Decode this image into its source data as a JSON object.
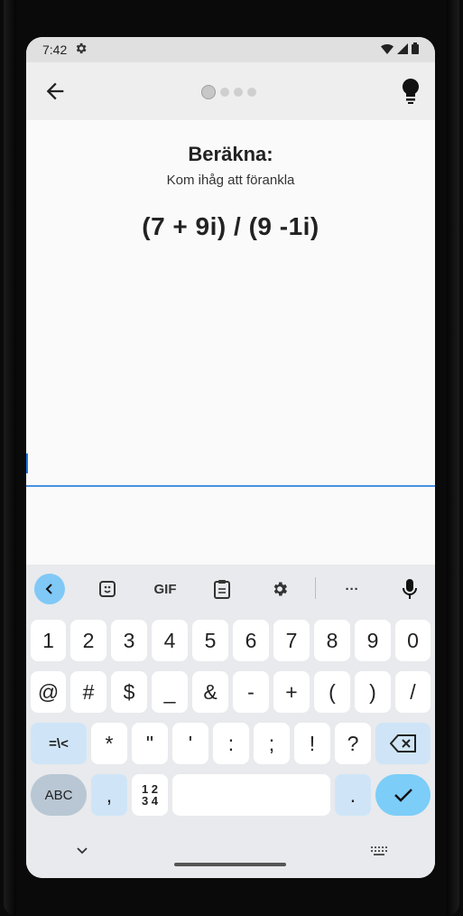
{
  "status": {
    "time": "7:42"
  },
  "appbar": {
    "progress_steps": 4,
    "active_step": 1
  },
  "exercise": {
    "title": "Beräkna:",
    "subtitle": "Kom ihåg att förankla",
    "expression": "(7 + 9i) / (9 -1i)"
  },
  "answer": {
    "value": "",
    "placeholder": ""
  },
  "keyboard": {
    "toolbar": [
      "back",
      "sticker",
      "GIF",
      "clipboard",
      "settings",
      "more",
      "mic"
    ],
    "gif_label": "GIF",
    "more_label": "···",
    "row1": [
      "1",
      "2",
      "3",
      "4",
      "5",
      "6",
      "7",
      "8",
      "9",
      "0"
    ],
    "row2": [
      "@",
      "#",
      "$",
      "_",
      "&",
      "-",
      "+",
      "(",
      ")",
      "/"
    ],
    "row3": [
      "=\\<",
      "*",
      "\"",
      "'",
      ":",
      ";",
      "!",
      "?"
    ],
    "abc_label": "ABC",
    "comma": ",",
    "numpad_label_top": "1 2",
    "numpad_label_bottom": "3 4",
    "period": "."
  }
}
